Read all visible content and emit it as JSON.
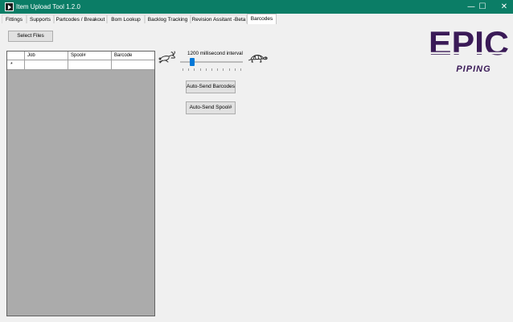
{
  "window": {
    "title": "Item Upload Tool 1.2.0",
    "minimize_glyph": "—",
    "maximize_glyph": "☐",
    "close_glyph": "✕"
  },
  "tabs": [
    {
      "label": "Fittings",
      "active": false
    },
    {
      "label": "Supports",
      "active": false
    },
    {
      "label": "Partcodes / Breakout",
      "active": false
    },
    {
      "label": "Bom Lookup",
      "active": false
    },
    {
      "label": "Backlog Tracking",
      "active": false
    },
    {
      "label": "Revision Assitant -Beta",
      "active": false
    },
    {
      "label": "Barcodes",
      "active": true
    }
  ],
  "toolbar": {
    "select_files_label": "Select Files"
  },
  "grid": {
    "columns": [
      "Job",
      "Spool#",
      "Barcode"
    ],
    "new_row_marker": "*"
  },
  "slider": {
    "interval_label": "1200 millisecond interval",
    "value_fraction": 0.15,
    "tick_count": 11,
    "left_icon": "rabbit-icon",
    "right_icon": "turtle-icon"
  },
  "actions": {
    "auto_send_barcodes_label": "Auto-Send Barcodes",
    "auto_send_spool_label": "Auto-Send Spool#"
  },
  "logo": {
    "wordmark": "EPIC",
    "subtitle": "PIPING",
    "color": "#3a1a57"
  },
  "colors": {
    "titlebar": "#0b7d66",
    "slider_thumb": "#0078d7",
    "grid_background": "#ababab"
  }
}
